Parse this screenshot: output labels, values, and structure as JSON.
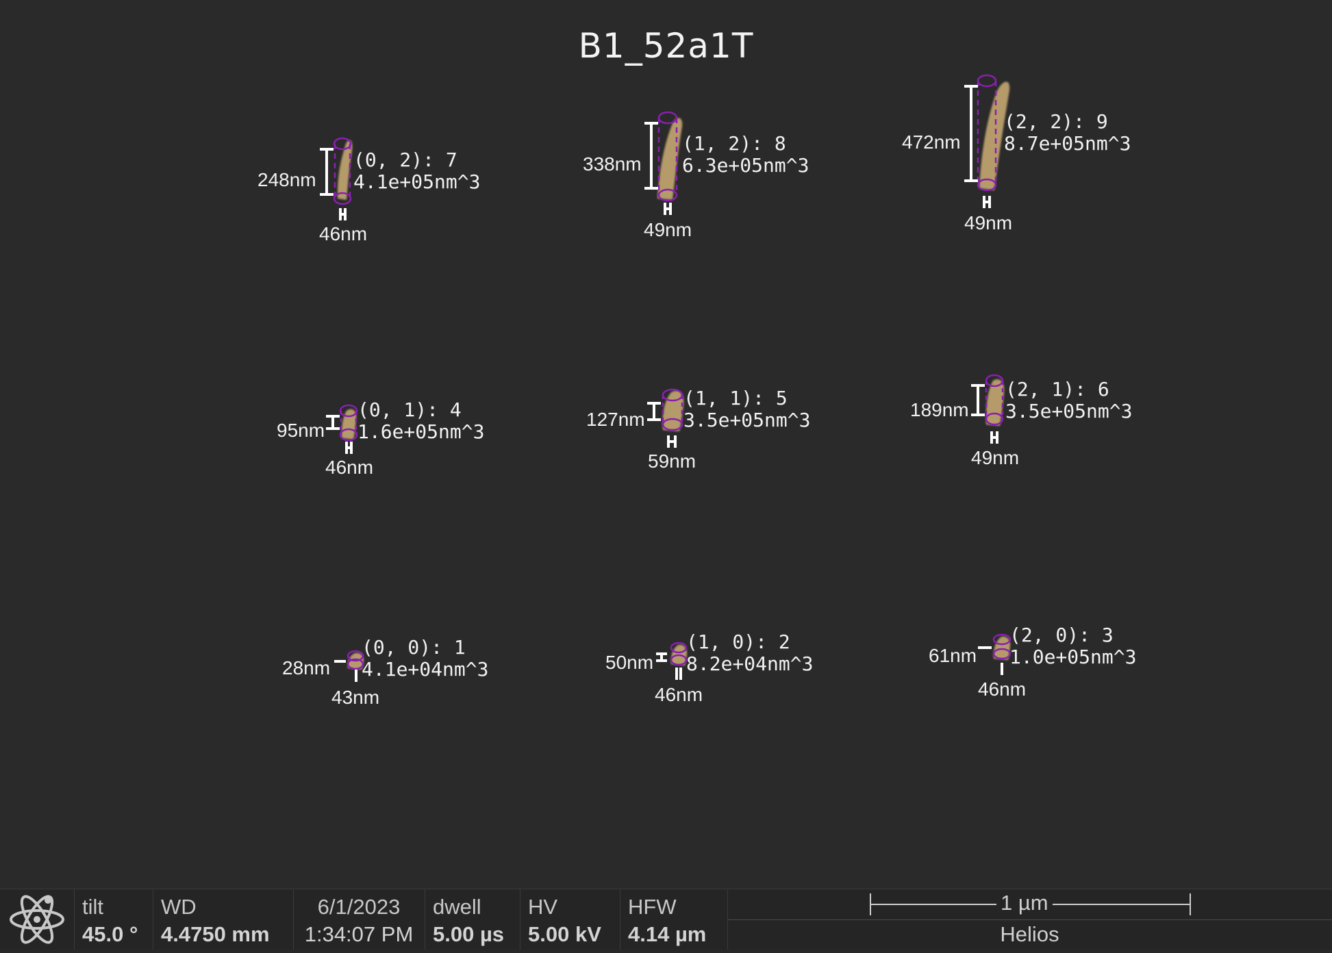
{
  "title": "B1_52a1T",
  "particles": [
    {
      "label": "(0, 2): 7",
      "volume": "4.1e+05nm^3",
      "height": "248nm",
      "width": "46nm"
    },
    {
      "label": "(1, 2): 8",
      "volume": "6.3e+05nm^3",
      "height": "338nm",
      "width": "49nm"
    },
    {
      "label": "(2, 2): 9",
      "volume": "8.7e+05nm^3",
      "height": "472nm",
      "width": "49nm"
    },
    {
      "label": "(0, 1): 4",
      "volume": "1.6e+05nm^3",
      "height": "95nm",
      "width": "46nm"
    },
    {
      "label": "(1, 1): 5",
      "volume": "3.5e+05nm^3",
      "height": "127nm",
      "width": "59nm"
    },
    {
      "label": "(2, 1): 6",
      "volume": "3.5e+05nm^3",
      "height": "189nm",
      "width": "49nm"
    },
    {
      "label": "(0, 0): 1",
      "volume": "4.1e+04nm^3",
      "height": "28nm",
      "width": "43nm"
    },
    {
      "label": "(1, 0): 2",
      "volume": "8.2e+04nm^3",
      "height": "50nm",
      "width": "46nm"
    },
    {
      "label": "(2, 0): 3",
      "volume": "1.0e+05nm^3",
      "height": "61nm",
      "width": "46nm"
    }
  ],
  "colors": {
    "background": "#2a2a2a",
    "particle": "#b59a6a",
    "outline": "#8a1fb0",
    "annotation": "#ffffff"
  },
  "databar": {
    "logo_icon": "atom-icon",
    "tilt": {
      "key": "tilt",
      "value": "45.0 °"
    },
    "wd": {
      "key": "WD",
      "value": "4.4750 mm"
    },
    "datetime": {
      "date": "6/1/2023",
      "time": "1:34:07 PM"
    },
    "dwell": {
      "key": "dwell",
      "value": "5.00 µs"
    },
    "hv": {
      "key": "HV",
      "value": "5.00 kV"
    },
    "hfw": {
      "key": "HFW",
      "value": "4.14 µm"
    },
    "scale_label": "1 µm",
    "instrument": "Helios"
  }
}
